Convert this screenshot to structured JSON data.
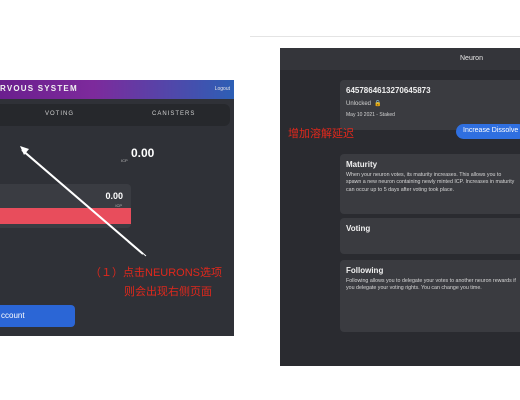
{
  "left_app": {
    "title": "RVOUS SYSTEM",
    "logout": "Logout",
    "tabs": [
      {
        "label": "VOTING"
      },
      {
        "label": "CANISTERS"
      }
    ],
    "balance": "0.00",
    "balance_unit": "ICP",
    "card_balance": "0.00",
    "card_unit": "ICP",
    "account_button": "ccount"
  },
  "annotations": {
    "left_step": "（１）点击NEURONS选项",
    "left_step_line2": "则会出现右侧页面",
    "right_note": "增加溶解延迟"
  },
  "right_app": {
    "header_title": "Neuron",
    "neuron": {
      "id": "6457864613270645873",
      "status": "Unlocked",
      "staked": "May 10 2021 - Staked",
      "button": "Increase Dissolve"
    },
    "maturity": {
      "title": "Maturity",
      "body": "When your neuron votes, its maturity increases. This allows you to spawn a new neuron containing newly minted ICP. Increases in maturity can occur up to 5 days after voting took place."
    },
    "voting": {
      "title": "Voting"
    },
    "following": {
      "title": "Following",
      "body": "Following allows you to delegate your votes to another neuron rewards if you delegate your voting rights. You can change you time."
    }
  },
  "colors": {
    "annotation_red": "#e0281c",
    "primary_blue": "#2f6fe0",
    "alert_red": "#e84d5c"
  }
}
